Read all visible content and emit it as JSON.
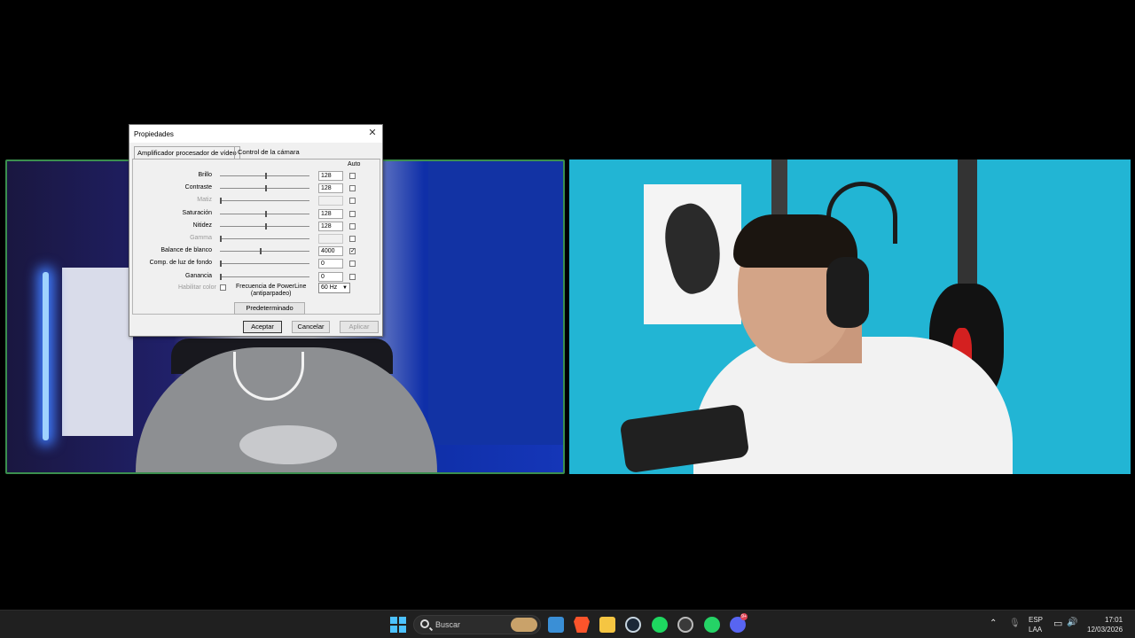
{
  "dialog": {
    "title": "Propiedades",
    "tabs": [
      "Amplificador procesador de vídeo",
      "Control de la cámara"
    ],
    "auto_header": "Auto",
    "rows": [
      {
        "label": "Brillo",
        "value": "128",
        "slider_fraction": 0.5,
        "auto": false,
        "disabled": false
      },
      {
        "label": "Contraste",
        "value": "128",
        "slider_fraction": 0.5,
        "auto": false,
        "disabled": false
      },
      {
        "label": "Matiz",
        "value": "",
        "slider_fraction": 0.0,
        "auto": false,
        "disabled": true
      },
      {
        "label": "Saturación",
        "value": "128",
        "slider_fraction": 0.5,
        "auto": false,
        "disabled": false
      },
      {
        "label": "Nitidez",
        "value": "128",
        "slider_fraction": 0.5,
        "auto": false,
        "disabled": false
      },
      {
        "label": "Gamma",
        "value": "",
        "slider_fraction": 0.0,
        "auto": false,
        "disabled": true
      },
      {
        "label": "Balance de blanco",
        "value": "4000",
        "slider_fraction": 0.45,
        "auto": true,
        "disabled": false
      },
      {
        "label": "Comp. de luz de fondo",
        "value": "0",
        "slider_fraction": 0.0,
        "auto": false,
        "disabled": false
      },
      {
        "label": "Ganancia",
        "value": "0",
        "slider_fraction": 0.0,
        "auto": false,
        "disabled": false
      }
    ],
    "color_enable_label": "Habilitar color",
    "powerline_label_1": "Frecuencia de PowerLine",
    "powerline_label_2": "(antiparpadeo)",
    "powerline_value": "60 Hz",
    "default_button": "Predeterminado",
    "ok_button": "Aceptar",
    "cancel_button": "Cancelar",
    "apply_button": "Aplicar"
  },
  "taskbar": {
    "search_placeholder": "Buscar",
    "language_1": "ESP",
    "language_2": "LAA",
    "time": "17:01",
    "date": "12/03/2026",
    "discord_badge": "9+"
  },
  "colors": {
    "accent": "#4cc2ff",
    "tile_border_active": "#3b8f4e",
    "right_wall": "#22b5d4"
  }
}
